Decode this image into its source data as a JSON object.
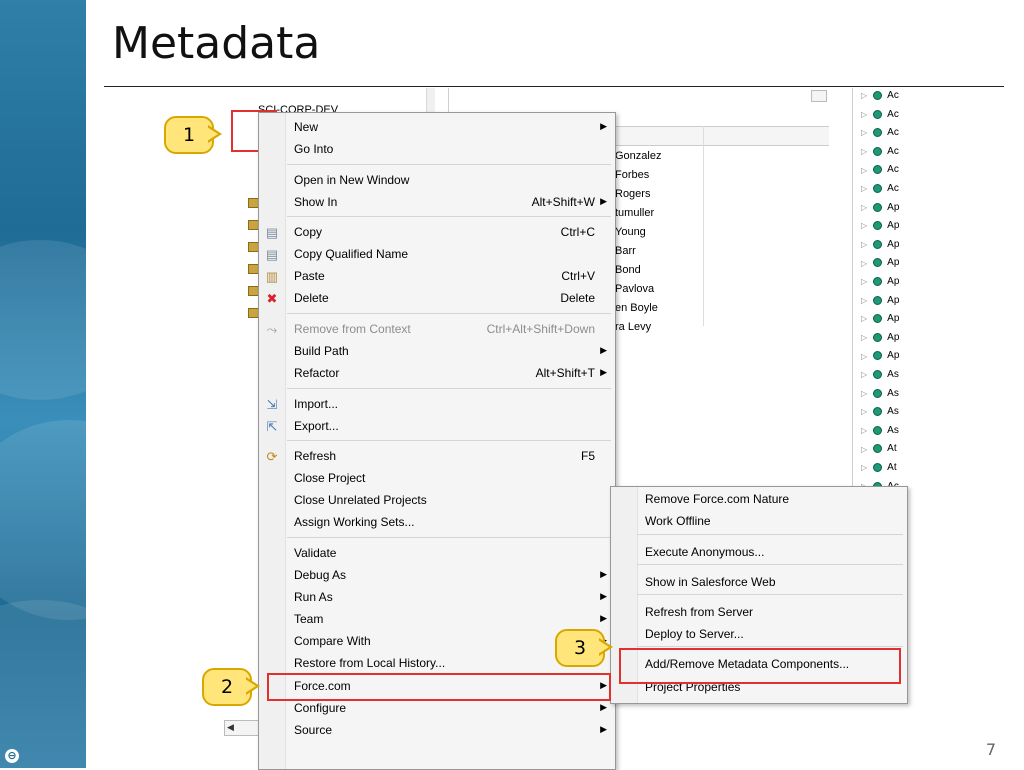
{
  "slide": {
    "title": "Metadata",
    "page_number": "7"
  },
  "tree": {
    "project_label": "SCI-CORP-DEV"
  },
  "table": {
    "header": "e",
    "rows": [
      "Gonzalez",
      "Forbes",
      "Rogers",
      "tumuller",
      "Young",
      "Barr",
      "Bond",
      "Pavlova",
      "en Boyle",
      "ra Levy"
    ]
  },
  "rlist": {
    "items": [
      "Ac",
      "Ac",
      "Ac",
      "Ac",
      "Ac",
      "Ac",
      "Ap",
      "Ap",
      "Ap",
      "Ap",
      "Ap",
      "Ap",
      "Ap",
      "Ap",
      "Ap",
      "As",
      "As",
      "As",
      "As",
      "At",
      "At",
      "Ac"
    ]
  },
  "context_menu": {
    "items": [
      {
        "label": "New",
        "shortcut": "",
        "submenu": true
      },
      {
        "label": "Go Into",
        "shortcut": "",
        "submenu": false
      },
      {
        "label": "Open in New Window",
        "shortcut": "",
        "submenu": false
      },
      {
        "label": "Show In",
        "shortcut": "Alt+Shift+W",
        "submenu": true
      },
      {
        "label": "Copy",
        "shortcut": "Ctrl+C",
        "submenu": false,
        "icon": "copy-icon"
      },
      {
        "label": "Copy Qualified Name",
        "shortcut": "",
        "submenu": false,
        "icon": "copy-qualified-name-icon"
      },
      {
        "label": "Paste",
        "shortcut": "Ctrl+V",
        "submenu": false,
        "icon": "paste-icon"
      },
      {
        "label": "Delete",
        "shortcut": "Delete",
        "submenu": false,
        "icon": "delete-icon"
      },
      {
        "label": "Remove from Context",
        "shortcut": "Ctrl+Alt+Shift+Down",
        "submenu": false,
        "disabled": true,
        "icon": "remove-context-icon"
      },
      {
        "label": "Build Path",
        "shortcut": "",
        "submenu": true
      },
      {
        "label": "Refactor",
        "shortcut": "Alt+Shift+T",
        "submenu": true
      },
      {
        "label": "Import...",
        "shortcut": "",
        "submenu": false,
        "icon": "import-icon"
      },
      {
        "label": "Export...",
        "shortcut": "",
        "submenu": false,
        "icon": "export-icon"
      },
      {
        "label": "Refresh",
        "shortcut": "F5",
        "submenu": false,
        "icon": "refresh-icon"
      },
      {
        "label": "Close Project",
        "shortcut": "",
        "submenu": false
      },
      {
        "label": "Close Unrelated Projects",
        "shortcut": "",
        "submenu": false
      },
      {
        "label": "Assign Working Sets...",
        "shortcut": "",
        "submenu": false
      },
      {
        "label": "Validate",
        "shortcut": "",
        "submenu": false
      },
      {
        "label": "Debug As",
        "shortcut": "",
        "submenu": true
      },
      {
        "label": "Run As",
        "shortcut": "",
        "submenu": true
      },
      {
        "label": "Team",
        "shortcut": "",
        "submenu": true
      },
      {
        "label": "Compare With",
        "shortcut": "",
        "submenu": true
      },
      {
        "label": "Restore from Local History...",
        "shortcut": "",
        "submenu": false
      },
      {
        "label": "Force.com",
        "shortcut": "",
        "submenu": true
      },
      {
        "label": "Configure",
        "shortcut": "",
        "submenu": true
      },
      {
        "label": "Source",
        "shortcut": "",
        "submenu": true
      }
    ]
  },
  "force_submenu": {
    "items": [
      "Remove Force.com Nature",
      "Work Offline",
      "Execute Anonymous...",
      "Show in Salesforce Web",
      "Refresh from Server",
      "Deploy to Server...",
      "Add/Remove Metadata Components...",
      "Project Properties"
    ]
  },
  "callouts": [
    "1",
    "2",
    "3"
  ],
  "colors": {
    "highlight": "#e0312f",
    "callout_fill": "#ffe57a",
    "callout_border": "#d8a700"
  }
}
